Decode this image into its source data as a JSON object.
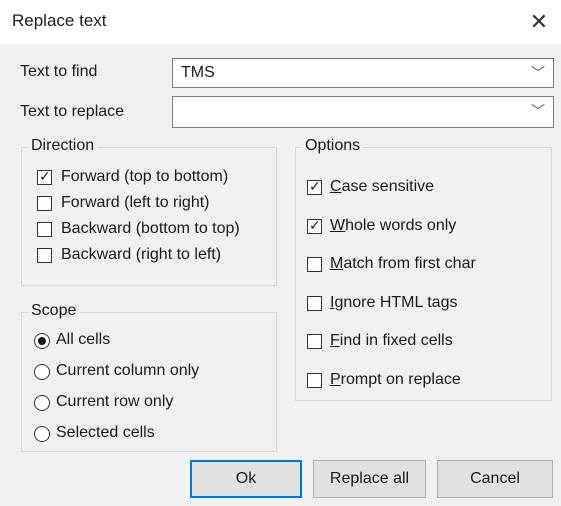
{
  "window": {
    "title": "Replace text"
  },
  "find": {
    "label": "Text to find",
    "value": "TMS"
  },
  "replace": {
    "label": "Text to replace",
    "value": ""
  },
  "direction": {
    "legend": "Direction",
    "options": [
      {
        "label": "Forward (top to bottom)",
        "checked": true
      },
      {
        "label": "Forward (left to right)",
        "checked": false
      },
      {
        "label": "Backward (bottom to top)",
        "checked": false
      },
      {
        "label": "Backward (right to left)",
        "checked": false
      }
    ]
  },
  "scope": {
    "legend": "Scope",
    "options": [
      {
        "label": "All cells",
        "selected": true
      },
      {
        "label": "Current column only",
        "selected": false
      },
      {
        "label": "Current row only",
        "selected": false
      },
      {
        "label": "Selected cells",
        "selected": false
      }
    ]
  },
  "options": {
    "legend": "Options",
    "items": [
      {
        "first": "C",
        "rest": "ase sensitive",
        "checked": true
      },
      {
        "first": "W",
        "rest": "hole words only",
        "checked": true
      },
      {
        "first": "M",
        "rest": "atch from first char",
        "checked": false
      },
      {
        "first": "I",
        "rest": "gnore HTML tags",
        "checked": false
      },
      {
        "first": "F",
        "rest": "ind in fixed cells",
        "checked": false
      },
      {
        "first": "P",
        "rest": "rompt on replace",
        "checked": false
      }
    ]
  },
  "buttons": {
    "ok": "Ok",
    "replace_all": "Replace all",
    "cancel": "Cancel"
  },
  "icons": {
    "close": "close-icon",
    "dropdown": "chevron-down-icon"
  }
}
